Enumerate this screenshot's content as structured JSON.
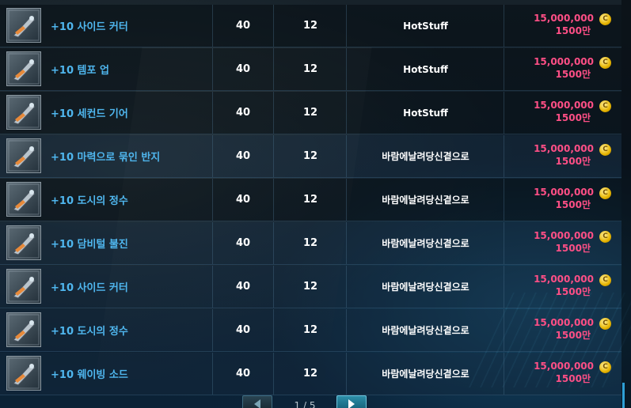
{
  "listing": {
    "rows": [
      {
        "name": "+10 사이드 커터",
        "level": "40",
        "count": "12",
        "seller": "HotStuff",
        "price": "15,000,000",
        "price_man": "1500만",
        "icon": "side-cutter-icon"
      },
      {
        "name": "+10 템포 업",
        "level": "40",
        "count": "12",
        "seller": "HotStuff",
        "price": "15,000,000",
        "price_man": "1500만",
        "icon": "tempo-up-icon"
      },
      {
        "name": "+10 세컨드 기어",
        "level": "40",
        "count": "12",
        "seller": "HotStuff",
        "price": "15,000,000",
        "price_man": "1500만",
        "icon": "second-gear-icon"
      },
      {
        "name": "+10 마력으로 묶인 반지",
        "level": "40",
        "count": "12",
        "seller": "바람에날려당신곁으로",
        "price": "15,000,000",
        "price_man": "1500만",
        "icon": "magic-ring-icon"
      },
      {
        "name": "+10 도시의 정수",
        "level": "40",
        "count": "12",
        "seller": "바람에날려당신곁으로",
        "price": "15,000,000",
        "price_man": "1500만",
        "icon": "city-essence-icon"
      },
      {
        "name": "+10 담비털 불진",
        "level": "40",
        "count": "12",
        "seller": "바람에날려당신곁으로",
        "price": "15,000,000",
        "price_man": "1500만",
        "icon": "sable-whisk-icon"
      },
      {
        "name": "+10 사이드 커터",
        "level": "40",
        "count": "12",
        "seller": "바람에날려당신곁으로",
        "price": "15,000,000",
        "price_man": "1500만",
        "icon": "side-cutter-icon"
      },
      {
        "name": "+10 도시의 정수",
        "level": "40",
        "count": "12",
        "seller": "바람에날려당신곁으로",
        "price": "15,000,000",
        "price_man": "1500만",
        "icon": "city-essence-icon"
      },
      {
        "name": "+10 웨이빙 소드",
        "level": "40",
        "count": "12",
        "seller": "바람에날려당신곁으로",
        "price": "15,000,000",
        "price_man": "1500만",
        "icon": "waving-sword-icon"
      }
    ]
  },
  "currency": {
    "symbol": "C",
    "icon": "gold-coin-icon"
  },
  "pager": {
    "text": "1 / 5",
    "prev_icon": "arrow-left-icon",
    "next_icon": "arrow-right-icon"
  },
  "colors": {
    "item_name": "#4fb6ee",
    "price": "#ff4f86",
    "coin": "#e6b400",
    "accent": "#2e9fd6"
  }
}
